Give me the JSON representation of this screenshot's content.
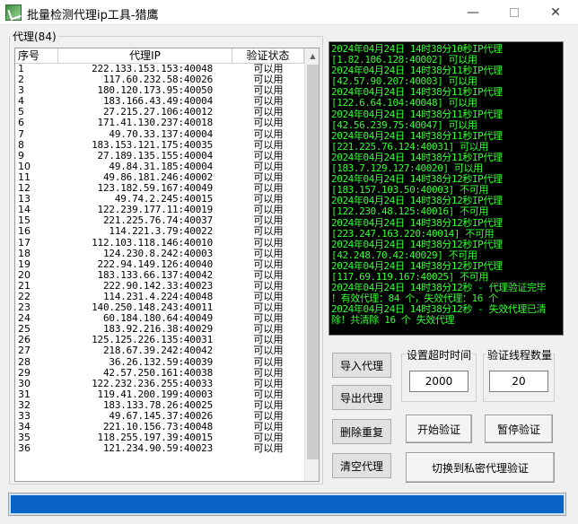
{
  "window": {
    "title": "批量检测代理ip工具-猎鹰",
    "min_glyph": "—",
    "close_glyph": "✕"
  },
  "group": {
    "label": "代理(84)"
  },
  "table": {
    "headers": [
      "序号",
      "代理IP",
      "验证状态"
    ],
    "rows": [
      [
        "1",
        "222.133.153.153:40048",
        "可以用"
      ],
      [
        "2",
        "117.60.232.58:40026",
        "可以用"
      ],
      [
        "3",
        "180.120.173.95:40050",
        "可以用"
      ],
      [
        "4",
        "183.166.43.49:40004",
        "可以用"
      ],
      [
        "5",
        "27.215.27.106:40012",
        "可以用"
      ],
      [
        "6",
        "171.41.130.237:40018",
        "可以用"
      ],
      [
        "7",
        "49.70.33.137:40004",
        "可以用"
      ],
      [
        "8",
        "183.153.121.175:40035",
        "可以用"
      ],
      [
        "9",
        "27.189.135.155:40004",
        "可以用"
      ],
      [
        "10",
        "49.84.31.185:40004",
        "可以用"
      ],
      [
        "11",
        "49.86.181.246:40002",
        "可以用"
      ],
      [
        "12",
        "123.182.59.167:40049",
        "可以用"
      ],
      [
        "13",
        "49.74.2.245:40015",
        "可以用"
      ],
      [
        "14",
        "122.239.177.11:40019",
        "可以用"
      ],
      [
        "15",
        "221.225.76.74:40037",
        "可以用"
      ],
      [
        "16",
        "114.221.3.79:40022",
        "可以用"
      ],
      [
        "17",
        "112.103.118.146:40010",
        "可以用"
      ],
      [
        "18",
        "124.230.8.242:40003",
        "可以用"
      ],
      [
        "19",
        "222.94.149.126:40040",
        "可以用"
      ],
      [
        "20",
        "183.133.66.137:40042",
        "可以用"
      ],
      [
        "21",
        "222.90.142.33:40023",
        "可以用"
      ],
      [
        "22",
        "114.231.4.224:40048",
        "可以用"
      ],
      [
        "23",
        "140.250.148.243:40011",
        "可以用"
      ],
      [
        "24",
        "60.184.180.64:40049",
        "可以用"
      ],
      [
        "25",
        "183.92.216.38:40029",
        "可以用"
      ],
      [
        "26",
        "125.125.226.135:40031",
        "可以用"
      ],
      [
        "27",
        "218.67.39.242:40042",
        "可以用"
      ],
      [
        "28",
        "36.26.132.59:40039",
        "可以用"
      ],
      [
        "29",
        "42.57.250.161:40038",
        "可以用"
      ],
      [
        "30",
        "122.232.236.255:40033",
        "可以用"
      ],
      [
        "31",
        "119.41.200.199:40003",
        "可以用"
      ],
      [
        "32",
        "183.133.78.26:40025",
        "可以用"
      ],
      [
        "33",
        "49.67.145.37:40026",
        "可以用"
      ],
      [
        "34",
        "221.10.156.73:40048",
        "可以用"
      ],
      [
        "35",
        "118.255.197.39:40015",
        "可以用"
      ],
      [
        "36",
        "121.234.90.59:40023",
        "可以用"
      ]
    ]
  },
  "log": [
    "2024年04月24日 14时38分10秒IP代理",
    "[1.82.106.128:40002] 可以用",
    "2024年04月24日 14时38分11秒IP代理",
    "[42.57.90.207:40003] 可以用",
    "2024年04月24日 14时38分11秒IP代理",
    "[122.6.64.104:40048] 可以用",
    "2024年04月24日 14时38分11秒IP代理",
    "[42.56.239.75:40047] 可以用",
    "2024年04月24日 14时38分11秒IP代理",
    "[221.225.76.124:40031] 可以用",
    "2024年04月24日 14时38分11秒IP代理",
    "[183.7.129.127:40020] 可以用",
    "2024年04月24日 14时38分12秒IP代理",
    "[183.157.103.50:40003] 不可用",
    "2024年04月24日 14时38分12秒IP代理",
    "[122.230.48.125:40016] 不可用",
    "2024年04月24日 14时38分12秒IP代理",
    "[223.247.163.220:40014] 不可用",
    "2024年04月24日 14时38分12秒IP代理",
    "[42.248.70.42:40029] 不可用",
    "2024年04月24日 14时38分12秒IP代理",
    "[117.69.119.167:40025] 不可用",
    "2024年04月24日 14时38分12秒 - 代理验证完毕",
    "！有效代理：84 个，失效代理：16 个",
    "2024年04月24日 14时38分12秒 - 失效代理已清",
    "除！共清除 16 个 失效代理"
  ],
  "controls": {
    "import_label": "导入代理",
    "export_label": "导出代理",
    "dedupe_label": "删除重复",
    "clear_label": "清空代理",
    "timeout_label": "设置超时时间",
    "timeout_value": "2000",
    "threads_label": "验证线程数量",
    "threads_value": "20",
    "start_label": "开始验证",
    "pause_label": "暂停验证",
    "switch_label": "切换到私密代理验证"
  },
  "colors": {
    "log_text": "#33ff33",
    "log_bg": "#000000",
    "progress": "#0a64c8"
  }
}
